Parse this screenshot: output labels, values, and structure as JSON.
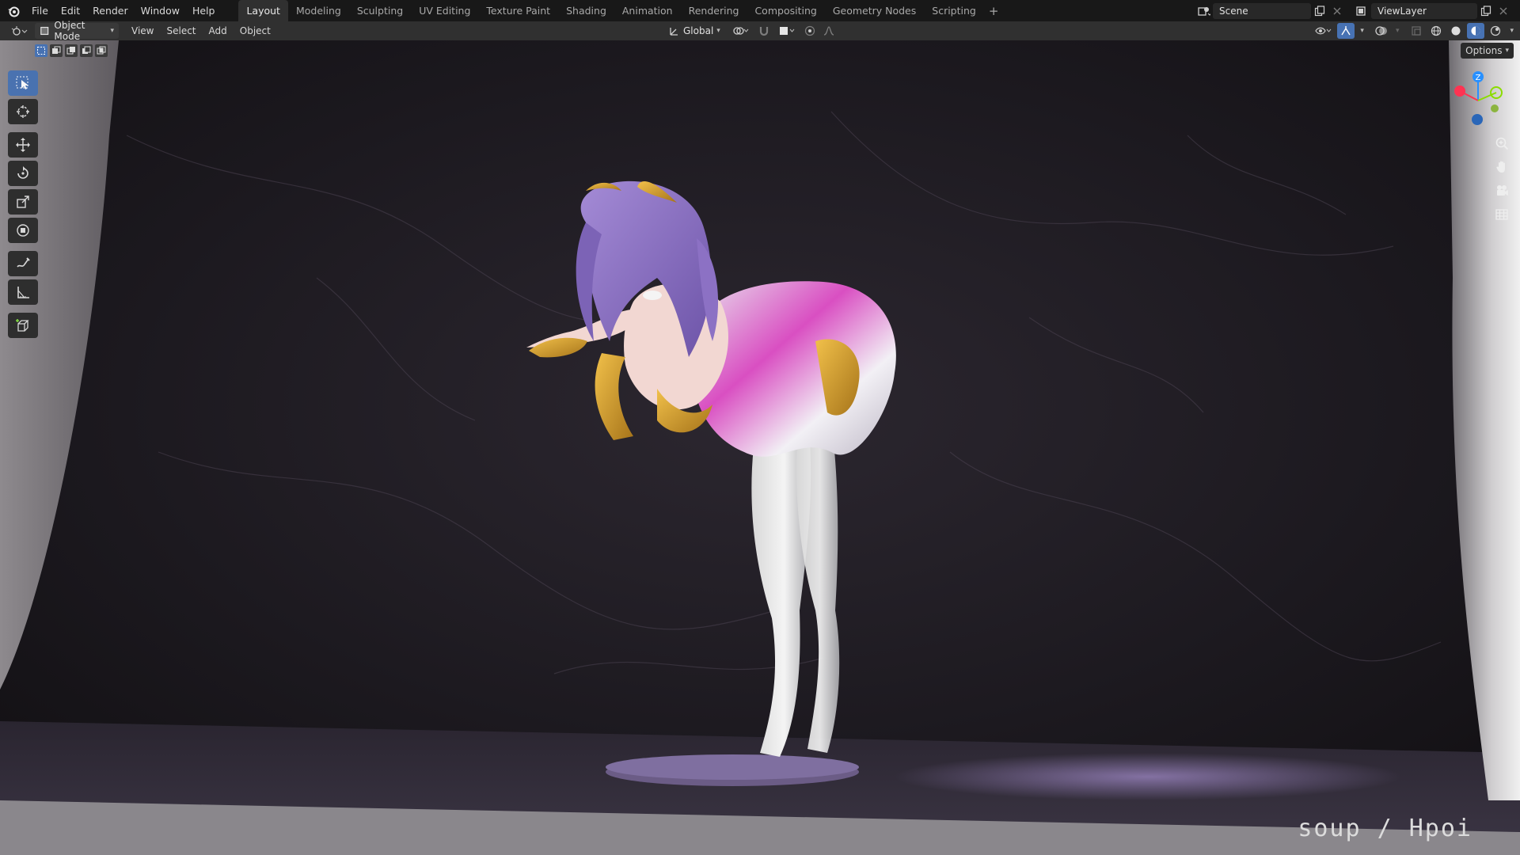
{
  "topbar": {
    "menus": [
      "File",
      "Edit",
      "Render",
      "Window",
      "Help"
    ],
    "workspace_tabs": [
      "Layout",
      "Modeling",
      "Sculpting",
      "UV Editing",
      "Texture Paint",
      "Shading",
      "Animation",
      "Rendering",
      "Compositing",
      "Geometry Nodes",
      "Scripting"
    ],
    "active_tab": "Layout",
    "add_tab": "+",
    "scene_name": "Scene",
    "view_layer": "ViewLayer"
  },
  "header": {
    "mode": "Object Mode",
    "menus": [
      "View",
      "Select",
      "Add",
      "Object"
    ],
    "transform_orientation": "Global"
  },
  "viewport": {
    "options_label": "Options",
    "gizmo_axes": [
      "Z"
    ],
    "watermark": "soup / Hpoi"
  },
  "toolbar": {
    "tools": [
      "select-box",
      "cursor",
      "move",
      "rotate",
      "scale",
      "transform",
      "annotate",
      "measure",
      "add-cube"
    ]
  },
  "colors": {
    "accent": "#4772b3",
    "x_axis": "#ff3352",
    "y_axis": "#8bdc00",
    "z_axis": "#2890ff"
  }
}
